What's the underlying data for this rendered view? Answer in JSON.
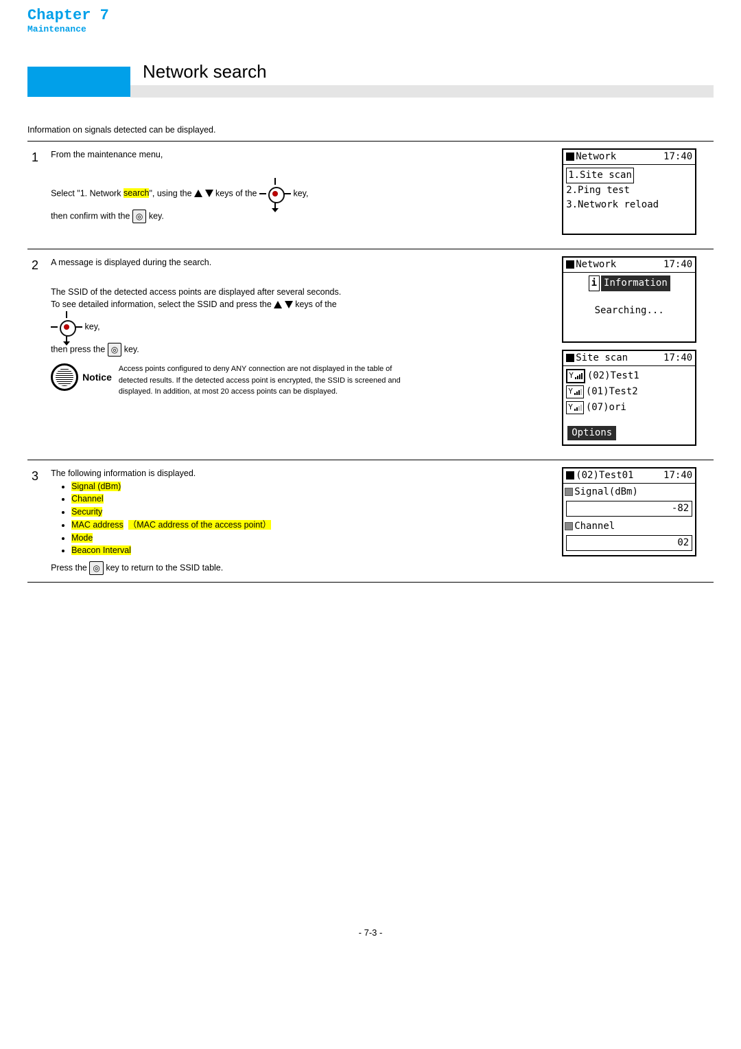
{
  "chapter": {
    "title": "Chapter 7",
    "subtitle": "Maintenance"
  },
  "page_title": "Network search",
  "intro": "Information on signals detected can be displayed.",
  "steps": {
    "s1": {
      "num": "1",
      "line1": "From the maintenance menu,",
      "line2a": "Select \"1. Network ",
      "line2b": "search",
      "line2c": "\", using the ",
      "line2d": " keys of the ",
      "line2e": " key,",
      "line3a": "then confirm with the ",
      "line3b": " key."
    },
    "s2": {
      "num": "2",
      "line1": "A message is displayed during the search.",
      "line2": "The SSID of the detected access points are displayed after several seconds.",
      "line3a": "To see detailed information, select the SSID and press the ",
      "line3b": " keys of the",
      "line4": "key,",
      "line5a": "then press the ",
      "line5b": " key.",
      "notice_label": "Notice",
      "notice_text": "Access points configured to deny ANY connection are not displayed in the table of detected results. If the detected access point is encrypted, the SSID is screened and displayed. In addition, at most 20 access points can be displayed."
    },
    "s3": {
      "num": "3",
      "line1": "The following information is displayed.",
      "bullets": {
        "b1": "Signal (dBm)",
        "b2": "Channel",
        "b3": "Security",
        "b4a": "MAC address",
        "b4b": "（MAC address of the access point）",
        "b5": "Mode",
        "b6": "Beacon Interval"
      },
      "line2a": "Press the ",
      "line2b": " key to return to the SSID table."
    }
  },
  "panels": {
    "p1": {
      "title": "Network",
      "time": "17:40",
      "item1": "1.Site scan",
      "item2": "2.Ping test",
      "item3": "3.Network reload"
    },
    "p2": {
      "title": "Network",
      "time": "17:40",
      "info_label": "Information",
      "searching": "Searching..."
    },
    "p3": {
      "title": "Site scan",
      "time": "17:40",
      "r1": "(02)Test1",
      "r2": "(01)Test2",
      "r3": "(07)ori",
      "options": "Options"
    },
    "p4": {
      "title": "(02)Test01",
      "time": "17:40",
      "sig_label": "Signal(dBm)",
      "sig_value": "-82",
      "ch_label": "Channel",
      "ch_value": "02"
    }
  },
  "footer": "- 7-3 -",
  "key_icon_glyph": "◎"
}
